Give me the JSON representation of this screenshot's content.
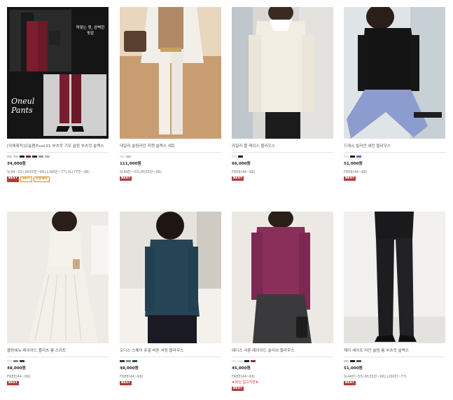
{
  "products": [
    {
      "name": "[자체제작]오늘팬츠vol.01 부츠컷 기모 슬림 부츠컷 슬랙스",
      "price": "34,000원",
      "size": "S(44~55),M(55반~66),L(66반~77),XL(77반~88)",
      "swatches": [
        "#cfcfcf",
        "#d8d0c4",
        "#222222",
        "#7a1d2e",
        "#2d2d44",
        "#9a9a9a",
        "#b9aed6"
      ],
      "badges": [
        {
          "label": "BEST",
          "type": "best"
        },
        {
          "label": "HOT",
          "type": "hot"
        },
        {
          "label": "주문제작",
          "type": "made"
        }
      ],
      "image_caption": "딱맞는 핏, 완벽한 핏감",
      "image_title": "Oneul\nPants"
    },
    {
      "name": "데일리 슬림라인 자켓 슬랙스 세트",
      "price": "111,000원",
      "size": "S(44반~55),M(55반~66)",
      "swatches": [
        "#e8e2d6",
        "#c8c4bc"
      ],
      "badges": [
        {
          "label": "BEST",
          "type": "best"
        }
      ]
    },
    {
      "name": "라일라 플 레이스 블라우스",
      "price": "66,000원",
      "size": "FREE(44~66)",
      "swatches": [
        "#ece7dd",
        "#222222"
      ],
      "badges": [
        {
          "label": "BEST",
          "type": "best"
        }
      ]
    },
    {
      "name": "드레시 빌리언 세턴 블라우스",
      "price": "51,000원",
      "size": "FREE(44~66)",
      "swatches": [
        "#ece7dd",
        "#222222",
        "#5a6ea8"
      ],
      "badges": [
        {
          "label": "BEST",
          "type": "best"
        }
      ]
    },
    {
      "name": "블랑에뉴 레이어드 플리츠 롱 스커트",
      "price": "48,000원",
      "size": "FREE(44~66)",
      "swatches": [
        "#ece7dd",
        "#8a8a8a",
        "#3a3a3a"
      ],
      "badges": [
        {
          "label": "BEST",
          "type": "best"
        }
      ]
    },
    {
      "name": "오디스 스퀘어 쥬얼 버튼 셔링 블라우스",
      "price": "48,000원",
      "size": "FREE(44~66)",
      "swatches": [
        "#3a3a3a",
        "#8a8a8a",
        "#2a4a5a"
      ],
      "badges": [
        {
          "label": "BEST",
          "type": "best"
        }
      ]
    },
    {
      "name": "에디스 셔룬 레이어드 슬리브 블라우스",
      "price": "45,000원",
      "size": "FREE(44~66)",
      "swatches": [
        "#ece7dd",
        "#ece7dd",
        "#222222",
        "#8a2e5a"
      ],
      "badges": [
        {
          "label": "BEST",
          "type": "best"
        }
      ],
      "note": "★와인 입고지연★"
    },
    {
      "name": "제이 셰이프 라인 슬림 롱 부츠컷 슬랙스",
      "price": "51,000원",
      "size": "S(44반~55),M(55반~66),L(66반~77)",
      "swatches": [
        "#cfcfcf",
        "#222222",
        "#555555"
      ],
      "badges": [
        {
          "label": "BEST",
          "type": "best"
        }
      ]
    }
  ]
}
